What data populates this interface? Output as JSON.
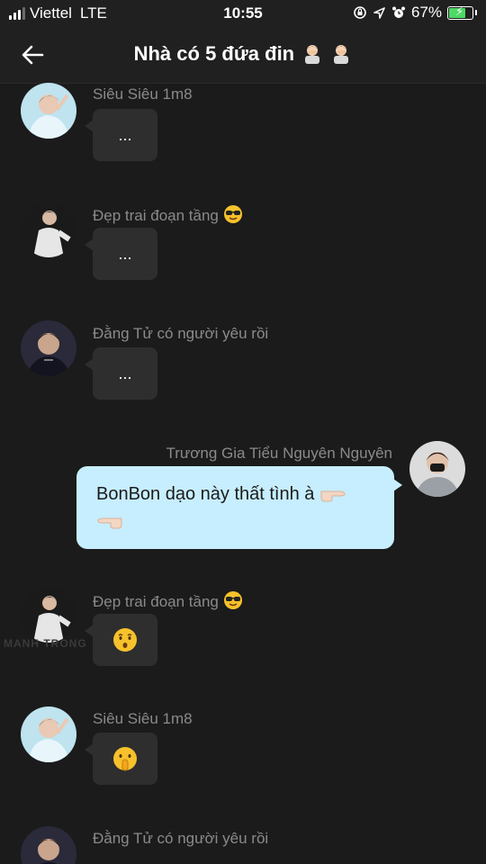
{
  "status_bar": {
    "carrier": "Viettel",
    "network": "LTE",
    "time": "10:55",
    "battery_percent": "67%",
    "battery_level": 0.67,
    "icons": [
      "lock-rotation-icon",
      "location-arrow-icon",
      "alarm-icon",
      "battery-charging-icon"
    ]
  },
  "header": {
    "title": "Nhà có 5 đứa đin",
    "title_emojis": [
      "person-facepalm-emoji",
      "person-facepalm-emoji"
    ],
    "back_icon": "back-arrow-icon"
  },
  "messages": [
    {
      "sender": "Siêu Siêu 1m8",
      "text": "...",
      "direction": "incoming",
      "avatar": "avatar-light-blue"
    },
    {
      "sender": "Đẹp trai đoạn tầng",
      "sender_emoji": "sunglasses-face-emoji",
      "text": "...",
      "direction": "incoming",
      "avatar": "avatar-white-shirt"
    },
    {
      "sender": "Đằng Tử có người yêu rồi",
      "text": "...",
      "direction": "incoming",
      "avatar": "avatar-dark"
    },
    {
      "sender": "Trương Gia Tiểu Nguyên Nguyên",
      "text": "BonBon dạo này thất tình à 👉🏻\n👈🏻",
      "line1": "BonBon dạo này thất tình à",
      "direction": "outgoing",
      "avatar": "avatar-masked"
    },
    {
      "sender": "Đẹp trai đoạn tầng",
      "sender_emoji": "sunglasses-face-emoji",
      "text": "",
      "emoji": "hushed-face-emoji",
      "direction": "incoming",
      "avatar": "avatar-white-shirt"
    },
    {
      "sender": "Siêu Siêu 1m8",
      "text": "",
      "emoji": "shushing-face-emoji",
      "direction": "incoming",
      "avatar": "avatar-light-blue"
    },
    {
      "sender": "Đằng Tử có người yêu rồi",
      "direction": "incoming",
      "avatar": "avatar-dark"
    }
  ],
  "colors": {
    "background": "#1b1b1b",
    "incoming_bubble": "#2e2e2e",
    "outgoing_bubble": "#c7eefe",
    "sender_name": "#8a8a8a"
  }
}
